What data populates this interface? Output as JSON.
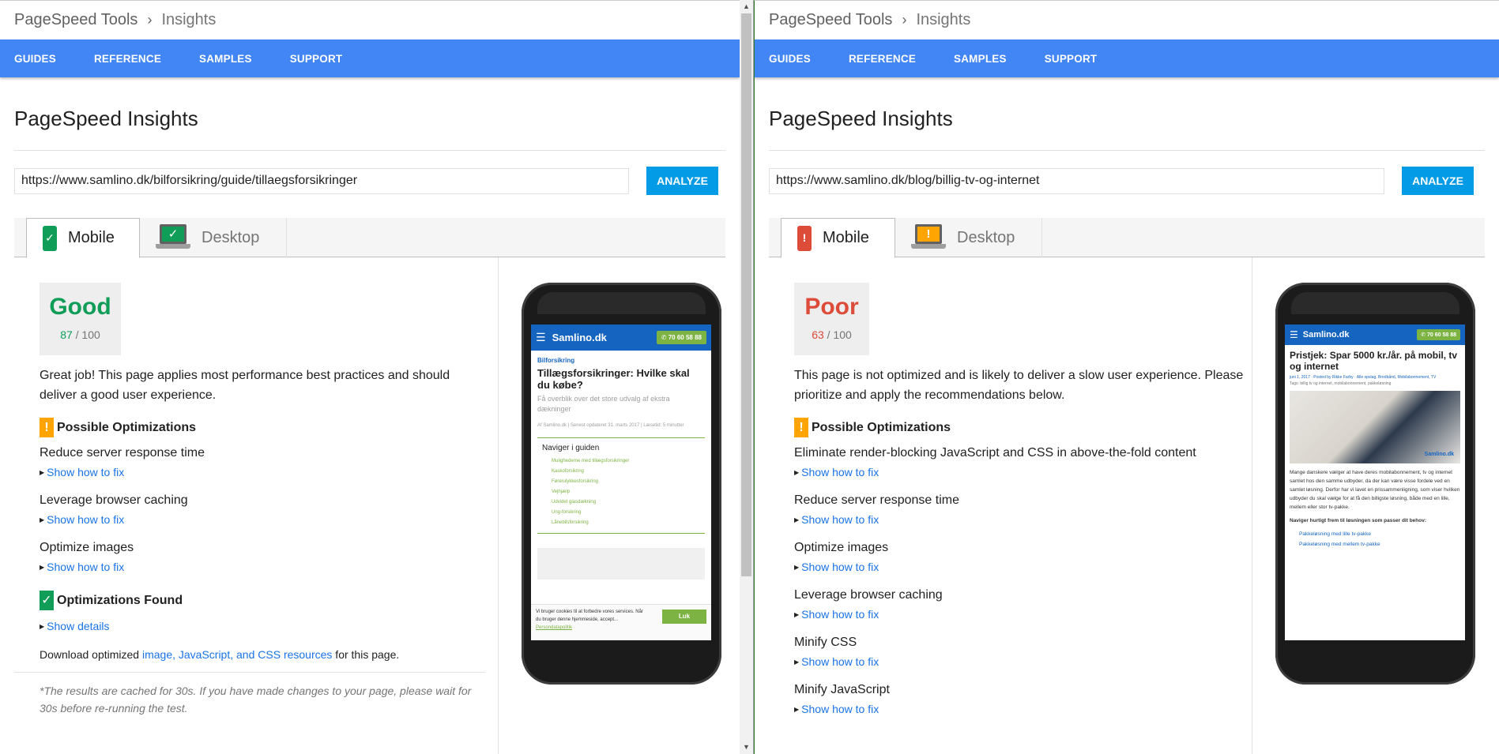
{
  "colors": {
    "nav": "#4285f4",
    "analyze": "#039be5",
    "good": "#0f9d58",
    "poor": "#dd4b39",
    "warn": "#ffa400",
    "link": "#1a73e8"
  },
  "left": {
    "breadcrumb": {
      "root": "PageSpeed Tools",
      "current": "Insights"
    },
    "nav": [
      "GUIDES",
      "REFERENCE",
      "SAMPLES",
      "SUPPORT"
    ],
    "page_title": "PageSpeed Insights",
    "url_value": "https://www.samlino.dk/bilforsikring/guide/tillaegsforsikringer",
    "analyze_label": "ANALYZE",
    "tabs": {
      "mobile": "Mobile",
      "desktop": "Desktop"
    },
    "verdict": "Good",
    "score": "87",
    "score_max": "/ 100",
    "summary": "Great job! This page applies most performance best practices and should deliver a good user experience.",
    "possible_title": "Possible Optimizations",
    "rules": [
      "Reduce server response time",
      "Leverage browser caching",
      "Optimize images"
    ],
    "show_fix": "Show how to fix",
    "found_title": "Optimizations Found",
    "show_details": "Show details",
    "download_prefix": "Download optimized ",
    "download_link": "image, JavaScript, and CSS resources",
    "download_suffix": " for this page.",
    "cache_note": "*The results are cached for 30s. If you have made changes to your page, please wait for 30s before re-running the test.",
    "preview": {
      "menu_label": "MENU",
      "logo": "Samlino.dk",
      "phone": "70 60 58 88",
      "category": "Bilforsikring",
      "headline": "Tillægsforsikringer: Hvilke skal du købe?",
      "subhead": "Få overblik over det store udvalg af ekstra dækninger",
      "meta": "Af Samlino.dk | Senest opdateret 31. marts 2017 | Læsetid: 5 minutter",
      "guide_title": "Naviger i guiden",
      "guide_items": [
        "Mulighederne med tillægsforsikringer",
        "Kaskoforsikring",
        "Førerulykkesforsikring",
        "Vejhjælp",
        "Udvidet glasdækning",
        "Ung-forsikring",
        "Lånebilsforsikring"
      ],
      "cookie_text": "Vi bruger cookies til at forbedre vores services. Når du bruger denne hjemmeside, accept...",
      "cookie_link": "Persondatapolitik",
      "cookie_ok": "Luk"
    }
  },
  "right": {
    "breadcrumb": {
      "root": "PageSpeed Tools",
      "current": "Insights"
    },
    "nav": [
      "GUIDES",
      "REFERENCE",
      "SAMPLES",
      "SUPPORT"
    ],
    "page_title": "PageSpeed Insights",
    "url_value": "https://www.samlino.dk/blog/billig-tv-og-internet",
    "analyze_label": "ANALYZE",
    "tabs": {
      "mobile": "Mobile",
      "desktop": "Desktop"
    },
    "verdict": "Poor",
    "score": "63",
    "score_max": "/ 100",
    "summary": "This page is not optimized and is likely to deliver a slow user experience. Please prioritize and apply the recommendations below.",
    "possible_title": "Possible Optimizations",
    "rules": [
      "Eliminate render-blocking JavaScript and CSS in above-the-fold content",
      "Reduce server response time",
      "Optimize images",
      "Leverage browser caching",
      "Minify CSS",
      "Minify JavaScript"
    ],
    "show_fix": "Show how to fix",
    "preview": {
      "logo": "Samlino.dk",
      "phone": "70 60 58 88",
      "headline": "Pristjek: Spar 5000 kr./år. på mobil, tv og internet",
      "meta": "juni 1, 2017 · Posted by Rikke Farby · Alle opslag, Bredbånd, Mobilabonnement, TV",
      "tags": "Tags: billig tv og internet, mobilabonnement, pakkeløsning",
      "photo_logo": "Samlino.dk",
      "para": "Mange danskere vælger at have deres mobilabonnement, tv og internet samlet hos den samme udbyder, da der kan være visse fordele ved en samlet løsning. Derfor har vi lavet en prissammenligning, som viser hvilken udbyder du skal vælge for at få den billigste løsning, både med en lille, mellem eller stor tv-pakke.",
      "nav_bold": "Naviger hurtigt frem til løsningen som passer dit behov:",
      "list": [
        "Pakkeløsning med lille tv-pakke",
        "Pakkeløsning med mellem tv-pakke"
      ]
    }
  }
}
